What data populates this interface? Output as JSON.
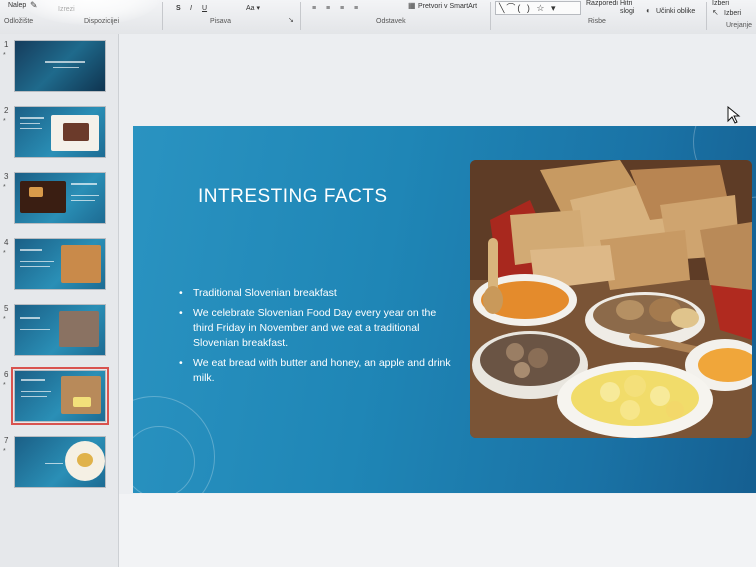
{
  "ribbon": {
    "clipboard_label": "Odložište",
    "new_slide_label": "Nalep",
    "paste_label": "Izrezi",
    "layout_label": "Dispozicijei",
    "font_group_label": "Pisava",
    "paragraph_group_label": "Odstavek",
    "smartart_label": "Pretvori v SmartArt",
    "drawing_group_label": "Risbe",
    "arrange_label": "Razporedi",
    "quick_styles_label": "Hitri slogi",
    "shape_effects_label": "Učinki oblike",
    "edit_label": "Urejanje",
    "replace_label": "Izberi",
    "select_label": "Izberi"
  },
  "thumbnails": [
    {
      "number": "1",
      "star": "*"
    },
    {
      "number": "2",
      "star": "*"
    },
    {
      "number": "3",
      "star": "*"
    },
    {
      "number": "4",
      "star": "*"
    },
    {
      "number": "5",
      "star": "*"
    },
    {
      "number": "6",
      "star": "*"
    },
    {
      "number": "7",
      "star": "*"
    }
  ],
  "slide": {
    "title": "INTRESTING FACTS",
    "bullets": [
      "Traditional Slovenian breakfast",
      "We celebrate Slovenian Food Day every year on the third Friday in November and we eat a traditional Slovenian breakfast.",
      "We eat bread with butter and honey, an apple and drink milk."
    ]
  },
  "colors": {
    "slide_bg": "#1f86b6",
    "selected_outline": "#d9534f",
    "ribbon_bg": "#eef0f2"
  }
}
